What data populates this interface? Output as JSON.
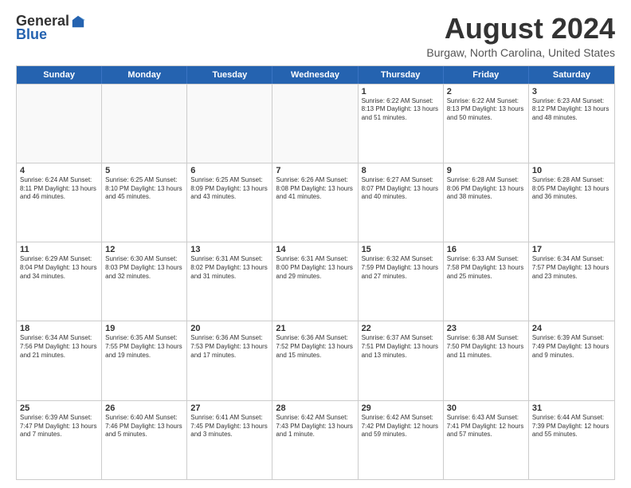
{
  "logo": {
    "general": "General",
    "blue": "Blue"
  },
  "title": {
    "month_year": "August 2024",
    "location": "Burgaw, North Carolina, United States"
  },
  "weekdays": [
    "Sunday",
    "Monday",
    "Tuesday",
    "Wednesday",
    "Thursday",
    "Friday",
    "Saturday"
  ],
  "weeks": [
    [
      {
        "day": "",
        "info": ""
      },
      {
        "day": "",
        "info": ""
      },
      {
        "day": "",
        "info": ""
      },
      {
        "day": "",
        "info": ""
      },
      {
        "day": "1",
        "info": "Sunrise: 6:22 AM\nSunset: 8:13 PM\nDaylight: 13 hours\nand 51 minutes."
      },
      {
        "day": "2",
        "info": "Sunrise: 6:22 AM\nSunset: 8:13 PM\nDaylight: 13 hours\nand 50 minutes."
      },
      {
        "day": "3",
        "info": "Sunrise: 6:23 AM\nSunset: 8:12 PM\nDaylight: 13 hours\nand 48 minutes."
      }
    ],
    [
      {
        "day": "4",
        "info": "Sunrise: 6:24 AM\nSunset: 8:11 PM\nDaylight: 13 hours\nand 46 minutes."
      },
      {
        "day": "5",
        "info": "Sunrise: 6:25 AM\nSunset: 8:10 PM\nDaylight: 13 hours\nand 45 minutes."
      },
      {
        "day": "6",
        "info": "Sunrise: 6:25 AM\nSunset: 8:09 PM\nDaylight: 13 hours\nand 43 minutes."
      },
      {
        "day": "7",
        "info": "Sunrise: 6:26 AM\nSunset: 8:08 PM\nDaylight: 13 hours\nand 41 minutes."
      },
      {
        "day": "8",
        "info": "Sunrise: 6:27 AM\nSunset: 8:07 PM\nDaylight: 13 hours\nand 40 minutes."
      },
      {
        "day": "9",
        "info": "Sunrise: 6:28 AM\nSunset: 8:06 PM\nDaylight: 13 hours\nand 38 minutes."
      },
      {
        "day": "10",
        "info": "Sunrise: 6:28 AM\nSunset: 8:05 PM\nDaylight: 13 hours\nand 36 minutes."
      }
    ],
    [
      {
        "day": "11",
        "info": "Sunrise: 6:29 AM\nSunset: 8:04 PM\nDaylight: 13 hours\nand 34 minutes."
      },
      {
        "day": "12",
        "info": "Sunrise: 6:30 AM\nSunset: 8:03 PM\nDaylight: 13 hours\nand 32 minutes."
      },
      {
        "day": "13",
        "info": "Sunrise: 6:31 AM\nSunset: 8:02 PM\nDaylight: 13 hours\nand 31 minutes."
      },
      {
        "day": "14",
        "info": "Sunrise: 6:31 AM\nSunset: 8:00 PM\nDaylight: 13 hours\nand 29 minutes."
      },
      {
        "day": "15",
        "info": "Sunrise: 6:32 AM\nSunset: 7:59 PM\nDaylight: 13 hours\nand 27 minutes."
      },
      {
        "day": "16",
        "info": "Sunrise: 6:33 AM\nSunset: 7:58 PM\nDaylight: 13 hours\nand 25 minutes."
      },
      {
        "day": "17",
        "info": "Sunrise: 6:34 AM\nSunset: 7:57 PM\nDaylight: 13 hours\nand 23 minutes."
      }
    ],
    [
      {
        "day": "18",
        "info": "Sunrise: 6:34 AM\nSunset: 7:56 PM\nDaylight: 13 hours\nand 21 minutes."
      },
      {
        "day": "19",
        "info": "Sunrise: 6:35 AM\nSunset: 7:55 PM\nDaylight: 13 hours\nand 19 minutes."
      },
      {
        "day": "20",
        "info": "Sunrise: 6:36 AM\nSunset: 7:53 PM\nDaylight: 13 hours\nand 17 minutes."
      },
      {
        "day": "21",
        "info": "Sunrise: 6:36 AM\nSunset: 7:52 PM\nDaylight: 13 hours\nand 15 minutes."
      },
      {
        "day": "22",
        "info": "Sunrise: 6:37 AM\nSunset: 7:51 PM\nDaylight: 13 hours\nand 13 minutes."
      },
      {
        "day": "23",
        "info": "Sunrise: 6:38 AM\nSunset: 7:50 PM\nDaylight: 13 hours\nand 11 minutes."
      },
      {
        "day": "24",
        "info": "Sunrise: 6:39 AM\nSunset: 7:49 PM\nDaylight: 13 hours\nand 9 minutes."
      }
    ],
    [
      {
        "day": "25",
        "info": "Sunrise: 6:39 AM\nSunset: 7:47 PM\nDaylight: 13 hours\nand 7 minutes."
      },
      {
        "day": "26",
        "info": "Sunrise: 6:40 AM\nSunset: 7:46 PM\nDaylight: 13 hours\nand 5 minutes."
      },
      {
        "day": "27",
        "info": "Sunrise: 6:41 AM\nSunset: 7:45 PM\nDaylight: 13 hours\nand 3 minutes."
      },
      {
        "day": "28",
        "info": "Sunrise: 6:42 AM\nSunset: 7:43 PM\nDaylight: 13 hours\nand 1 minute."
      },
      {
        "day": "29",
        "info": "Sunrise: 6:42 AM\nSunset: 7:42 PM\nDaylight: 12 hours\nand 59 minutes."
      },
      {
        "day": "30",
        "info": "Sunrise: 6:43 AM\nSunset: 7:41 PM\nDaylight: 12 hours\nand 57 minutes."
      },
      {
        "day": "31",
        "info": "Sunrise: 6:44 AM\nSunset: 7:39 PM\nDaylight: 12 hours\nand 55 minutes."
      }
    ]
  ]
}
